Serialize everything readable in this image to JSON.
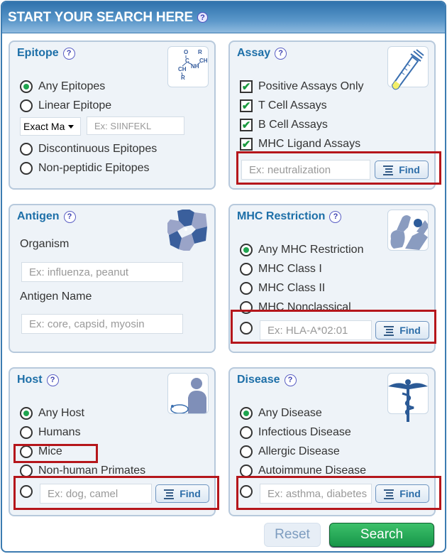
{
  "header": {
    "title": "START YOUR SEARCH HERE",
    "help": "?"
  },
  "epitope": {
    "title": "Epitope",
    "help": "?",
    "image": "peptide-structure-icon",
    "options": [
      {
        "label": "Any Epitopes",
        "selected": true
      },
      {
        "label": "Linear Epitope",
        "selected": false
      },
      {
        "label": "Discontinuous Epitopes",
        "selected": false
      },
      {
        "label": "Non-peptidic Epitopes",
        "selected": false
      }
    ],
    "match_select": "Exact Ma",
    "sequence_placeholder": "Ex: SIINFEKL"
  },
  "assay": {
    "title": "Assay",
    "help": "?",
    "image": "test-tube-icon",
    "checkboxes": [
      {
        "label": "Positive Assays Only",
        "checked": true
      },
      {
        "label": "T Cell Assays",
        "checked": true
      },
      {
        "label": "B Cell Assays",
        "checked": true
      },
      {
        "label": "MHC Ligand Assays",
        "checked": true
      }
    ],
    "placeholder": "Ex: neutralization",
    "find_label": "Find"
  },
  "antigen": {
    "title": "Antigen",
    "help": "?",
    "image": "protein-structure-icon",
    "organism_label": "Organism",
    "organism_placeholder": "Ex: influenza, peanut",
    "name_label": "Antigen Name",
    "name_placeholder": "Ex: core, capsid, myosin"
  },
  "mhc": {
    "title": "MHC Restriction",
    "help": "?",
    "image": "mhc-molecule-icon",
    "options": [
      {
        "label": "Any MHC Restriction",
        "selected": true
      },
      {
        "label": "MHC Class I",
        "selected": false
      },
      {
        "label": "MHC Class II",
        "selected": false
      },
      {
        "label": "MHC Nonclassical",
        "selected": false
      }
    ],
    "placeholder": "Ex: HLA-A*02:01",
    "find_label": "Find"
  },
  "host": {
    "title": "Host",
    "help": "?",
    "image": "human-mouse-icon",
    "options": [
      {
        "label": "Any Host",
        "selected": true
      },
      {
        "label": "Humans",
        "selected": false
      },
      {
        "label": "Mice",
        "selected": false
      },
      {
        "label": "Non-human Primates",
        "selected": false
      }
    ],
    "placeholder": "Ex: dog, camel",
    "find_label": "Find"
  },
  "disease": {
    "title": "Disease",
    "help": "?",
    "image": "caduceus-icon",
    "options": [
      {
        "label": "Any Disease",
        "selected": true
      },
      {
        "label": "Infectious Disease",
        "selected": false
      },
      {
        "label": "Allergic Disease",
        "selected": false
      },
      {
        "label": "Autoimmune Disease",
        "selected": false
      }
    ],
    "placeholder": "Ex: asthma, diabetes",
    "find_label": "Find"
  },
  "actions": {
    "reset_label": "Reset",
    "search_label": "Search"
  },
  "colors": {
    "accent": "#1d6fa8",
    "search_green": "#1fa44f",
    "highlight_red": "#b5161b"
  }
}
